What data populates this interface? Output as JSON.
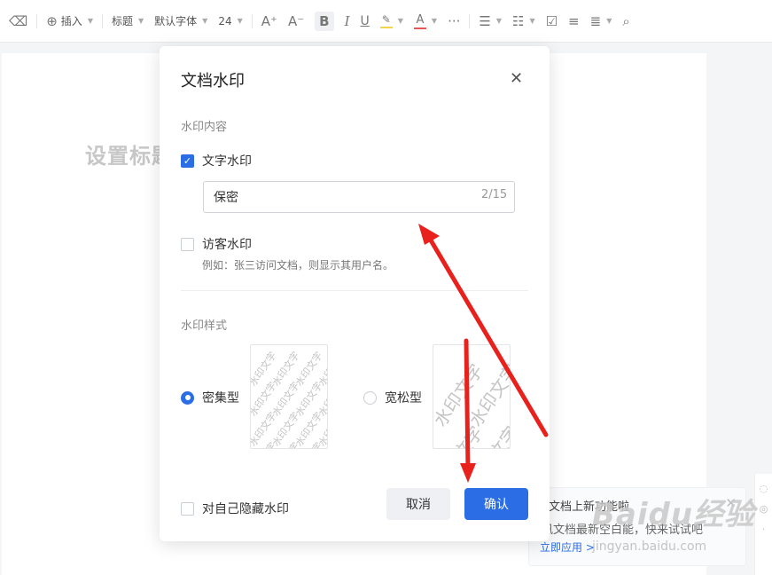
{
  "toolbar": {
    "insert_label": "插入",
    "heading_label": "标题",
    "font_label": "默认字体",
    "size_label": "24",
    "font_grow": "A⁺",
    "font_shrink": "A⁻",
    "bold": "B",
    "italic": "I",
    "underline": "U",
    "highlight_color": "#f2d44c",
    "text_color": "#e55757",
    "more": "···"
  },
  "document": {
    "title": "设置标题"
  },
  "dialog": {
    "title": "文档水印",
    "content_section_label": "水印内容",
    "text_watermark": {
      "label": "文字水印",
      "checked": true
    },
    "input": {
      "value": "保密",
      "count": "2/15"
    },
    "visitor_watermark": {
      "label": "访客水印",
      "checked": false
    },
    "visitor_hint": "例如：张三访问文档，则显示其用户名。",
    "style_section_label": "水印样式",
    "dense": {
      "label": "密集型",
      "selected": true,
      "preview_text": "水印文字"
    },
    "loose": {
      "label": "宽松型",
      "selected": false,
      "preview_text": "水印文字"
    },
    "hide_self": {
      "label": "对自己隐藏水印",
      "checked": false
    },
    "cancel_label": "取消",
    "confirm_label": "确认"
  },
  "notification": {
    "title": "文档上新功能啦",
    "body": "讯文档最新空白能，快来试试吧",
    "action": "立即应用 >"
  },
  "watermark": {
    "brand": "Baidu经验",
    "url": "jingyan.baidu.com"
  },
  "colors": {
    "accent": "#2b6de5",
    "arrow": "#e8211d"
  }
}
